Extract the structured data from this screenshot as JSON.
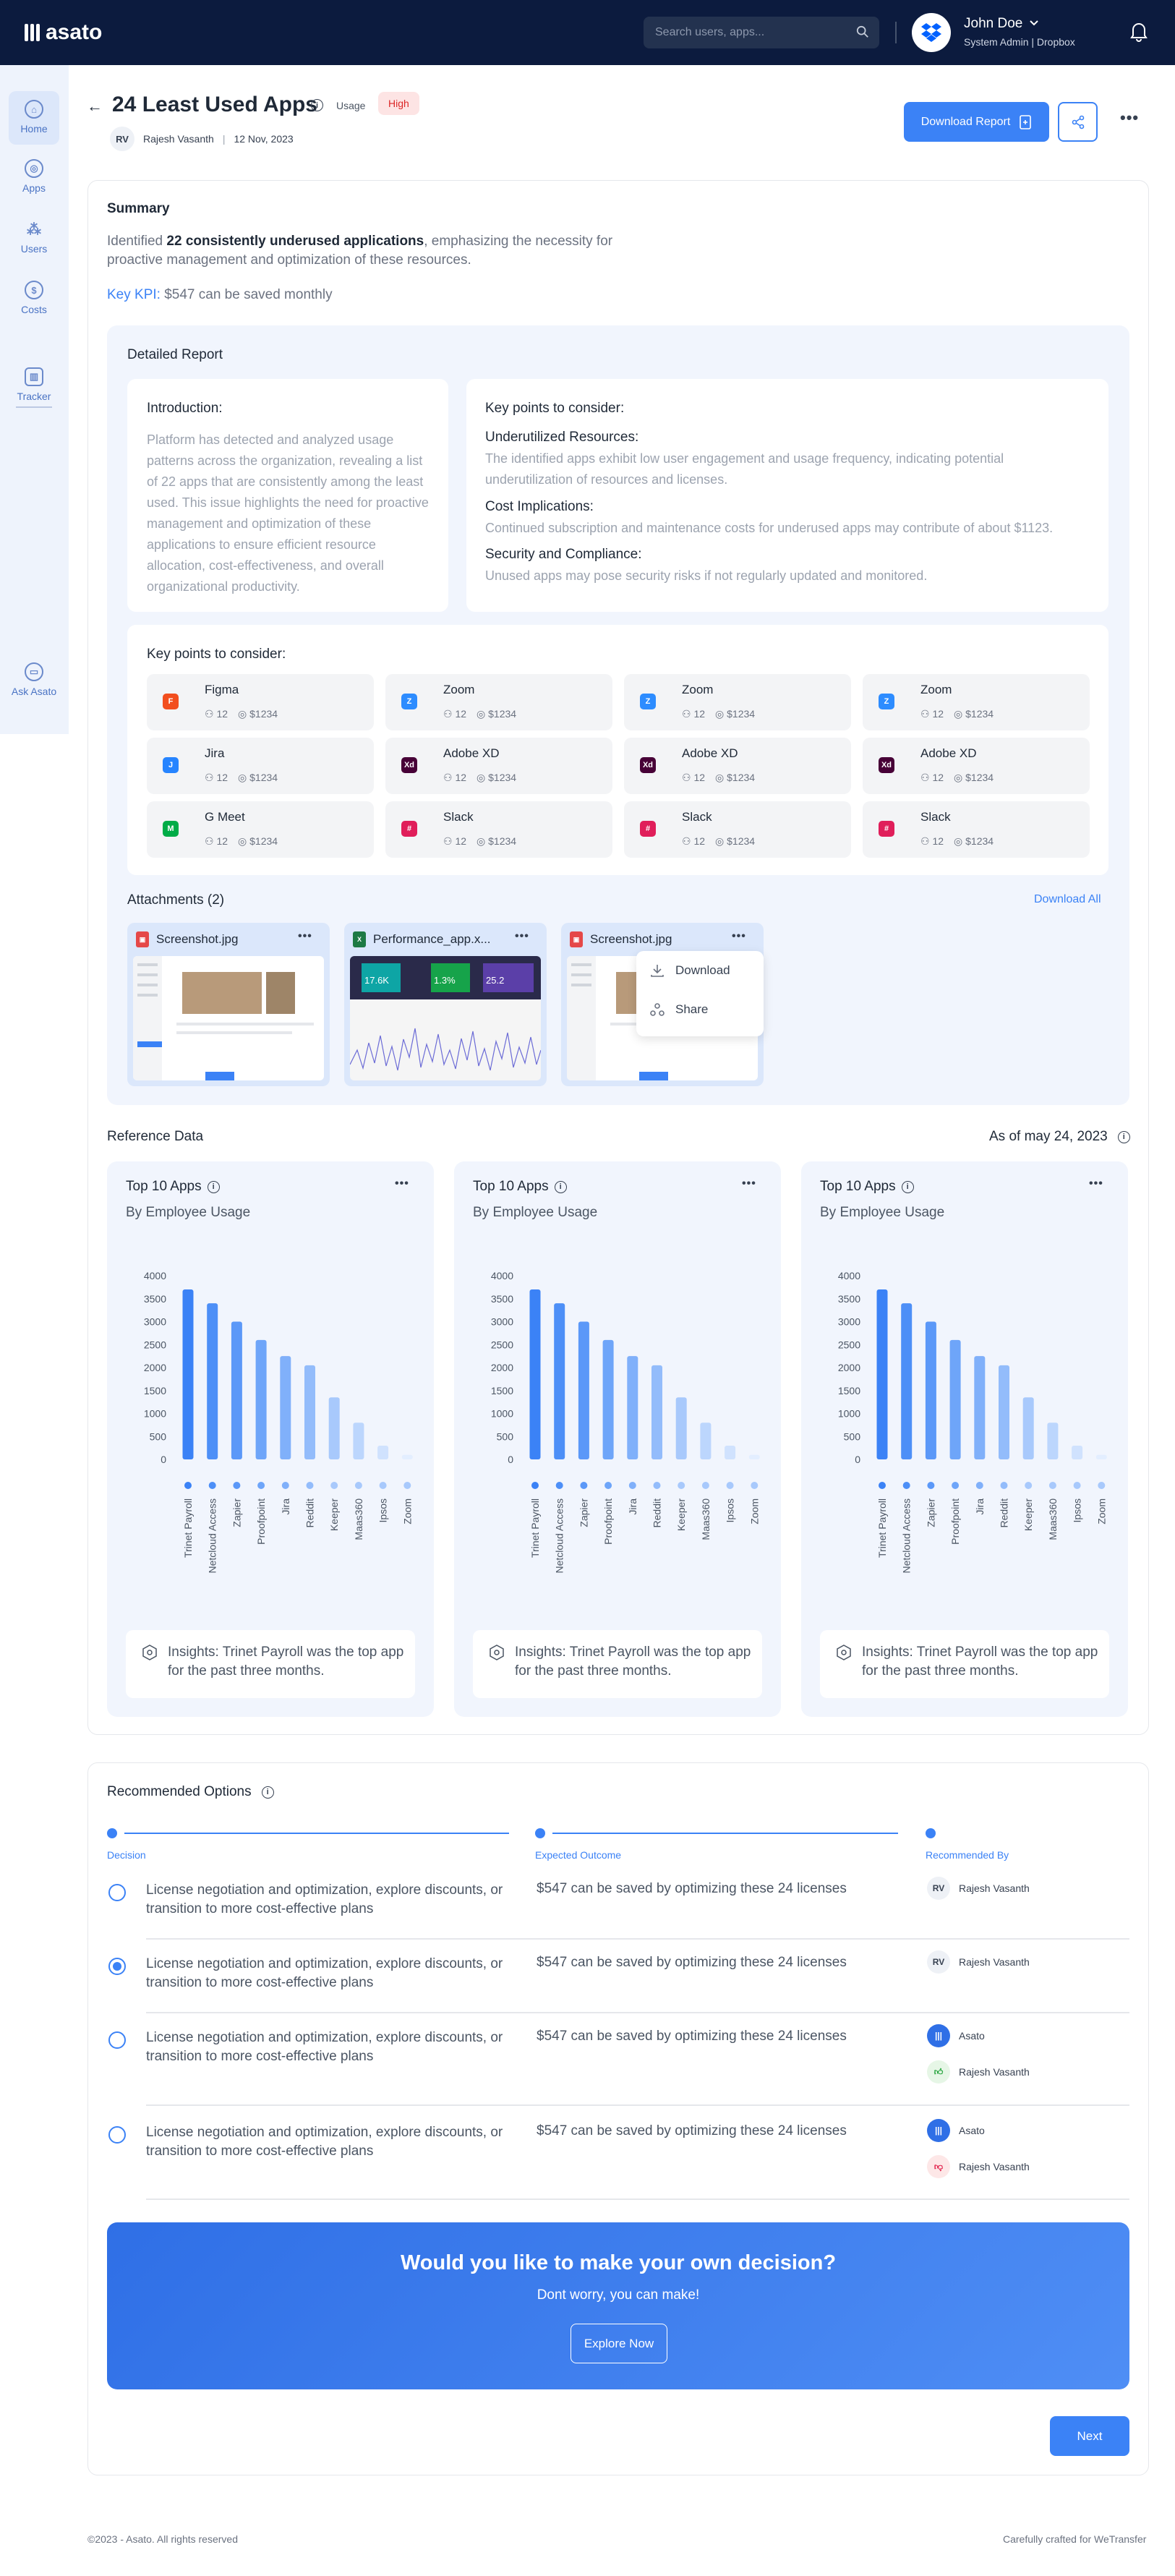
{
  "topbar": {
    "logo_text": "asato",
    "search_placeholder": "Search users, apps...",
    "user_name": "John Doe",
    "user_role": "System Admin | Dropbox"
  },
  "sidebar": {
    "items": [
      {
        "label": "Home",
        "icon": "home-icon",
        "active": true
      },
      {
        "label": "Apps",
        "icon": "apps-icon"
      },
      {
        "label": "Users",
        "icon": "users-icon"
      },
      {
        "label": "Costs",
        "icon": "dollar-icon"
      },
      {
        "label": "Tracker",
        "icon": "tracker-icon"
      },
      {
        "label": "Ask Asato",
        "icon": "chat-icon"
      }
    ]
  },
  "header": {
    "title": "24 Least Used Apps",
    "category": "Usage",
    "priority": "High",
    "author_initials": "RV",
    "author": "Rajesh Vasanth",
    "date": "12 Nov, 2023",
    "download_label": "Download Report"
  },
  "summary": {
    "title": "Summary",
    "text_pre": "Identified ",
    "text_bold": "22 consistently underused applications",
    "text_post": ", emphasizing the necessity for proactive management and optimization of these resources.",
    "kpi_label": "Key KPI:",
    "kpi_value": " $547 can be saved monthly"
  },
  "detailed": {
    "title": "Detailed Report",
    "intro_title": "Introduction:",
    "intro_text": "Platform has detected and analyzed usage patterns across the organization, revealing a list of 22 apps that are consistently among the least used. This issue highlights the need for proactive management and optimization of these applications to ensure efficient resource allocation, cost-effectiveness, and overall organizational productivity.",
    "kp_title": "Key points to consider:",
    "kp": [
      {
        "h": "Underutilized Resources:",
        "t": "The identified apps exhibit low user engagement and usage frequency, indicating potential underutilization of resources and licenses."
      },
      {
        "h": "Cost Implications:",
        "t": "Continued subscription and maintenance costs for underused apps may contribute of about $1123."
      },
      {
        "h": "Security and Compliance:",
        "t": "Unused apps may pose security risks if not regularly updated and monitored."
      }
    ],
    "apps_title": "Key points to consider:",
    "apps": [
      {
        "name": "Figma",
        "users": "12",
        "cost": "$1234",
        "color": "#f24e1e",
        "glyph": "F"
      },
      {
        "name": "Zoom",
        "users": "12",
        "cost": "$1234",
        "color": "#2d8cff",
        "glyph": "Z"
      },
      {
        "name": "Zoom",
        "users": "12",
        "cost": "$1234",
        "color": "#2d8cff",
        "glyph": "Z"
      },
      {
        "name": "Zoom",
        "users": "12",
        "cost": "$1234",
        "color": "#2d8cff",
        "glyph": "Z"
      },
      {
        "name": "Jira",
        "users": "12",
        "cost": "$1234",
        "color": "#2684ff",
        "glyph": "J"
      },
      {
        "name": "Adobe XD",
        "users": "12",
        "cost": "$1234",
        "color": "#470137",
        "glyph": "Xd"
      },
      {
        "name": "Adobe XD",
        "users": "12",
        "cost": "$1234",
        "color": "#470137",
        "glyph": "Xd"
      },
      {
        "name": "Adobe XD",
        "users": "12",
        "cost": "$1234",
        "color": "#470137",
        "glyph": "Xd"
      },
      {
        "name": "G Meet",
        "users": "12",
        "cost": "$1234",
        "color": "#00ac47",
        "glyph": "M"
      },
      {
        "name": "Slack",
        "users": "12",
        "cost": "$1234",
        "color": "#e01e5a",
        "glyph": "#"
      },
      {
        "name": "Slack",
        "users": "12",
        "cost": "$1234",
        "color": "#e01e5a",
        "glyph": "#"
      },
      {
        "name": "Slack",
        "users": "12",
        "cost": "$1234",
        "color": "#e01e5a",
        "glyph": "#"
      }
    ]
  },
  "attachments": {
    "title": "Attachments (2)",
    "download_all": "Download All",
    "files": [
      {
        "name": "Screenshot.jpg",
        "type": "jpg",
        "color": "#e54848"
      },
      {
        "name": "Performance_app.x...",
        "type": "xls",
        "color": "#1d7a44"
      },
      {
        "name": "Screenshot.jpg",
        "type": "jpg",
        "color": "#e54848"
      }
    ],
    "menu": {
      "download": "Download",
      "share": "Share"
    },
    "preview_numbers": [
      "17.6K",
      "1.3%",
      "25.2"
    ]
  },
  "reference": {
    "title": "Reference Data",
    "as_of": "As of may 24, 2023"
  },
  "charts": [
    {
      "title": "Top 10 Apps",
      "subtitle": "By Employee Usage",
      "insight": "Insights: Trinet Payroll was the top app for the past three months."
    },
    {
      "title": "Top 10 Apps",
      "subtitle": "By Employee Usage",
      "insight": "Insights: Trinet Payroll was the top app for the past three months."
    },
    {
      "title": "Top 10 Apps",
      "subtitle": "By Employee Usage",
      "insight": "Insights: Trinet Payroll was the top app for the past three months."
    }
  ],
  "chart_data": [
    {
      "type": "bar",
      "title": "Top 10 Apps",
      "subtitle": "By Employee Usage",
      "categories": [
        "Trinet Payroll",
        "Netcloud Access",
        "Zapier",
        "Proofpoint",
        "Jira",
        "Reddit",
        "Keeper",
        "Maas360",
        "Ipsos",
        "Zoom"
      ],
      "values": [
        3700,
        3400,
        3000,
        2600,
        2250,
        2050,
        1350,
        800,
        300,
        100
      ],
      "yticks": [
        "4000",
        "3500",
        "3000",
        "2500",
        "2000",
        "1500",
        "1000",
        "500",
        "0"
      ],
      "ylim": [
        0,
        4000
      ],
      "grid": false
    },
    {
      "type": "bar",
      "title": "Top 10 Apps",
      "subtitle": "By Employee Usage",
      "categories": [
        "Trinet Payroll",
        "Netcloud Access",
        "Zapier",
        "Proofpoint",
        "Jira",
        "Reddit",
        "Keeper",
        "Maas360",
        "Ipsos",
        "Zoom"
      ],
      "values": [
        3700,
        3400,
        3000,
        2600,
        2250,
        2050,
        1350,
        800,
        300,
        100
      ],
      "yticks": [
        "4000",
        "3500",
        "3000",
        "2500",
        "2000",
        "1500",
        "1000",
        "500",
        "0"
      ],
      "ylim": [
        0,
        4000
      ],
      "grid": false
    },
    {
      "type": "bar",
      "title": "Top 10 Apps",
      "subtitle": "By Employee Usage",
      "categories": [
        "Trinet Payroll",
        "Netcloud Access",
        "Zapier",
        "Proofpoint",
        "Jira",
        "Reddit",
        "Keeper",
        "Maas360",
        "Ipsos",
        "Zoom"
      ],
      "values": [
        3700,
        3400,
        3000,
        2600,
        2250,
        2050,
        1350,
        800,
        300,
        100
      ],
      "yticks": [
        "4000",
        "3500",
        "3000",
        "2500",
        "2000",
        "1500",
        "1000",
        "500",
        "0"
      ],
      "ylim": [
        0,
        4000
      ],
      "grid": false
    }
  ],
  "bar_colors": [
    "#3b82f6",
    "#4d8ff7",
    "#5b98f8",
    "#6ea5f9",
    "#80b0fa",
    "#93bcfb",
    "#a8c9fc",
    "#bcd6fd",
    "#d0e2fe",
    "#e3eeff"
  ],
  "recommended": {
    "title": "Recommended Options",
    "steps": [
      "Decision",
      "Expected Outcome",
      "Recommended By"
    ],
    "options": [
      {
        "decision": "License negotiation and optimization, explore discounts, or transition to more cost-effective plans",
        "outcome": "$547 can be saved by optimizing  these 24 licenses",
        "recommenders": [
          {
            "initials": "RV",
            "name": "Rajesh Vasanth"
          }
        ],
        "selected": false
      },
      {
        "decision": "License negotiation and optimization, explore discounts, or transition to more cost-effective plans",
        "outcome": "$547 can be saved by optimizing  these 24 licenses",
        "recommenders": [
          {
            "initials": "RV",
            "name": "Rajesh Vasanth"
          }
        ],
        "selected": true
      },
      {
        "decision": "License negotiation and optimization, explore discounts, or transition to more cost-effective plans",
        "outcome": "$547 can be saved by optimizing  these 24 licenses",
        "recommenders": [
          {
            "initials": "",
            "name": "Asato",
            "icon": "asato-logo-icon"
          },
          {
            "initials": "",
            "name": "Rajesh Vasanth",
            "icon": "thumbs-up-icon"
          }
        ],
        "selected": false
      },
      {
        "decision": "License negotiation and optimization, explore discounts, or transition to more cost-effective plans",
        "outcome": "$547 can be saved by optimizing  these 24 licenses",
        "recommenders": [
          {
            "initials": "",
            "name": "Asato",
            "icon": "asato-logo-icon"
          },
          {
            "initials": "",
            "name": "Rajesh Vasanth",
            "icon": "thumbs-down-icon"
          }
        ],
        "selected": false
      }
    ]
  },
  "cta": {
    "title": "Would you like to make your own decision?",
    "subtitle": "Dont worry, you can make!",
    "button": "Explore Now"
  },
  "next_label": "Next",
  "footer": {
    "left": "©2023 - Asato. All rights reserved",
    "right": "Carefully crafted for WeTransfer"
  }
}
